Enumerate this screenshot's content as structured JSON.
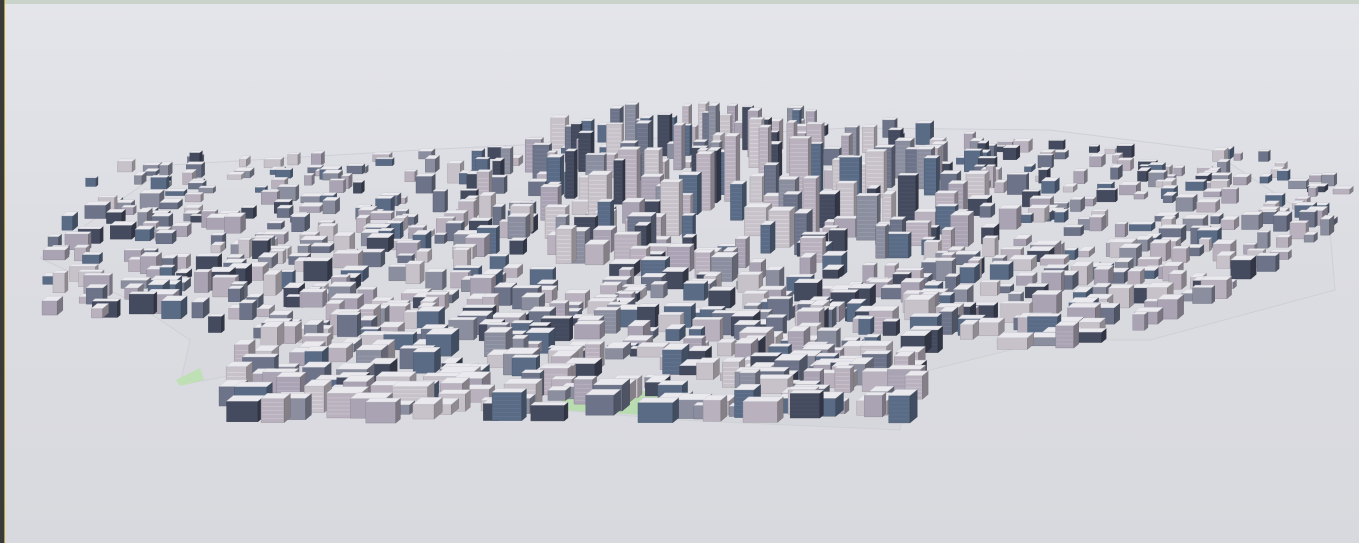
{
  "viewport": {
    "mode": "3d-perspective",
    "subject": "city-model"
  },
  "colors": {
    "sky": "#e2e3e8",
    "ground": "#d9dadf",
    "building_light": "#b9b1bd",
    "building_mid": "#8a8e9e",
    "building_dark": "#454b5e",
    "building_blue": "#5a6b86",
    "roof": "#e9e9ee",
    "park": "#b9dcb0"
  }
}
